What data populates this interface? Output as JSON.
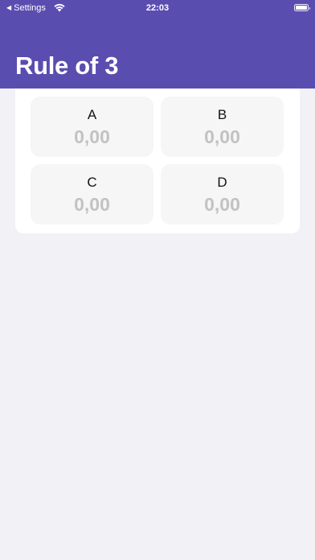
{
  "status_bar": {
    "back_label": "Settings",
    "time": "22:03",
    "wifi_icon": "wifi-icon",
    "battery_icon": "battery-icon"
  },
  "header": {
    "title": "Rule of 3",
    "color": "#5a4db0"
  },
  "fields": [
    {
      "label": "A",
      "placeholder": "0,00"
    },
    {
      "label": "B",
      "placeholder": "0,00"
    },
    {
      "label": "C",
      "placeholder": "0,00"
    },
    {
      "label": "D",
      "placeholder": "0,00"
    }
  ]
}
